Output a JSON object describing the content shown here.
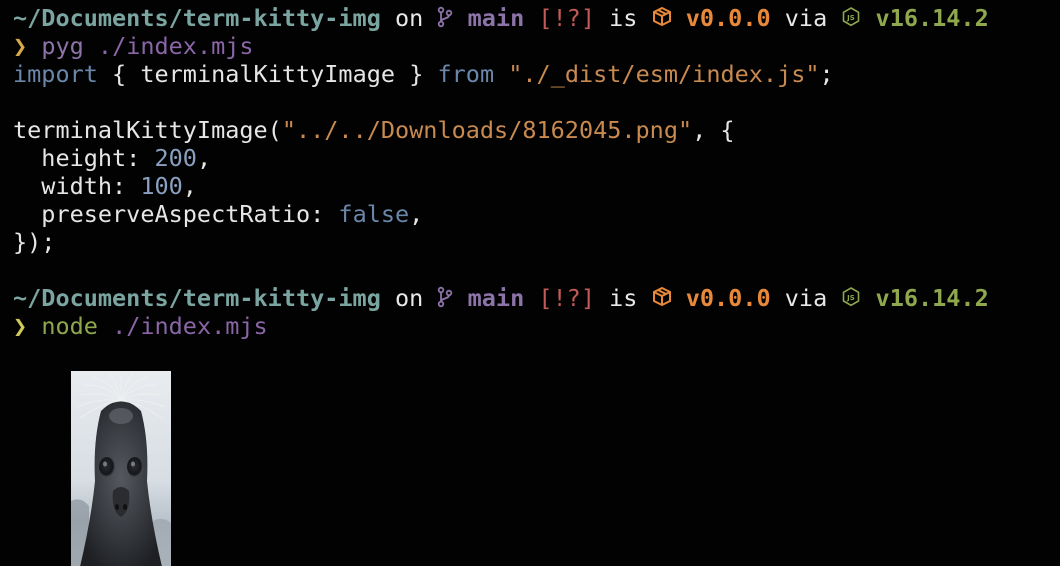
{
  "prompts": [
    {
      "path": "~/Documents/term-kitty-img",
      "on": "on",
      "branch": "main",
      "status": "[!?]",
      "is": "is",
      "package_version": "v0.0.0",
      "via": "via",
      "node_version": "v16.14.2",
      "prompt_char": "❯",
      "command_name": "pyg",
      "command_arg": "./index.mjs"
    },
    {
      "path": "~/Documents/term-kitty-img",
      "on": "on",
      "branch": "main",
      "status": "[!?]",
      "is": "is",
      "package_version": "v0.0.0",
      "via": "via",
      "node_version": "v16.14.2",
      "prompt_char": "❯",
      "command_name": "node",
      "command_arg": "./index.mjs"
    }
  ],
  "code": {
    "import_kw": "import",
    "import_open": "{",
    "import_name": "terminalKittyImage",
    "import_close": "}",
    "from_kw": "from",
    "import_path": "\"./_dist/esm/index.js\"",
    "semicolon": ";",
    "call_name": "terminalKittyImage",
    "call_open": "(",
    "call_arg": "\"../../Downloads/8162045.png\"",
    "call_comma_brace": ", {",
    "height_key": "height:",
    "height_val": "200",
    "width_key": "width:",
    "width_val": "100",
    "preserve_key": "preserveAspectRatio:",
    "preserve_val": "false",
    "comma": ",",
    "closing": "});"
  },
  "icons": {
    "branch": "git-branch-icon",
    "package": "package-box-icon",
    "node": "nodejs-hexagon-icon"
  },
  "image": {
    "subject": "seal-face-image"
  },
  "colors": {
    "background": "#020202",
    "path": "#7aa5a0",
    "branch": "#8d74a8",
    "status": "#c25a58",
    "package": "#e8893a",
    "node": "#8fa84d",
    "string": "#c88a50",
    "keyword": "#6a86a8",
    "number": "#8aa0c0"
  }
}
